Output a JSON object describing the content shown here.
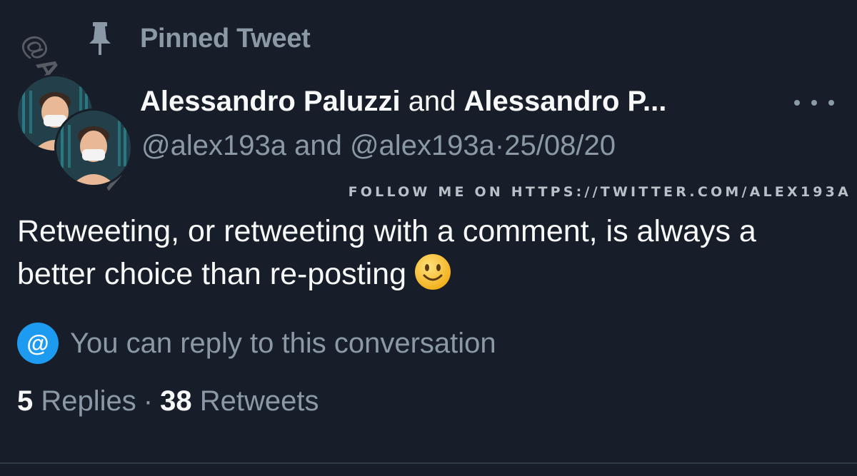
{
  "pinned": {
    "label": "Pinned Tweet",
    "icon": "pin-icon"
  },
  "author": {
    "name_1": "Alessandro Paluzzi",
    "conjunction": "and",
    "name_2": "Alessandro P...",
    "handle_1": "@alex193a",
    "handle_conjunction": "and",
    "handle_2": "@alex193a",
    "separator": "·",
    "date": "25/08/20"
  },
  "watermark": {
    "follow_text": "FOLLOW ME ON HTTPS://TWITTER.COM/ALEX193A",
    "side_text": "@ALEX193A"
  },
  "tweet": {
    "text": "Retweeting, or retweeting with a comment, is always a better choice than re-posting",
    "emoji": "smiling-face-icon"
  },
  "reply_settings": {
    "icon_glyph": "@",
    "text": "You can reply to this conversation"
  },
  "stats": {
    "replies_count": "5",
    "replies_label": "Replies",
    "separator": "·",
    "retweets_count": "38",
    "retweets_label": "Retweets"
  },
  "colors": {
    "background": "#171e29",
    "primary_text": "#f7f9f9",
    "secondary_text": "#8b98a5",
    "accent": "#1d9bf0"
  }
}
